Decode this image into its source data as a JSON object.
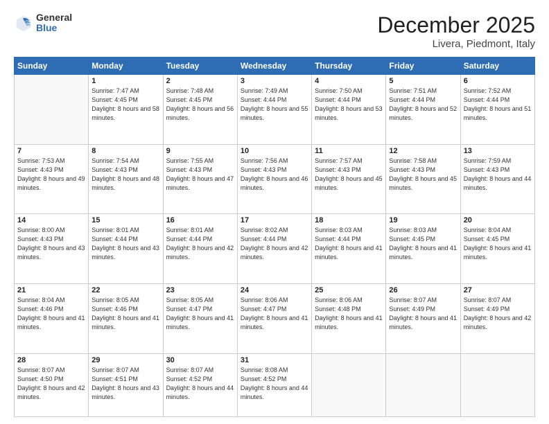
{
  "header": {
    "logo_general": "General",
    "logo_blue": "Blue",
    "month": "December 2025",
    "location": "Livera, Piedmont, Italy"
  },
  "days_of_week": [
    "Sunday",
    "Monday",
    "Tuesday",
    "Wednesday",
    "Thursday",
    "Friday",
    "Saturday"
  ],
  "weeks": [
    [
      {
        "day": "",
        "detail": ""
      },
      {
        "day": "1",
        "detail": "Sunrise: 7:47 AM\nSunset: 4:45 PM\nDaylight: 8 hours\nand 58 minutes."
      },
      {
        "day": "2",
        "detail": "Sunrise: 7:48 AM\nSunset: 4:45 PM\nDaylight: 8 hours\nand 56 minutes."
      },
      {
        "day": "3",
        "detail": "Sunrise: 7:49 AM\nSunset: 4:44 PM\nDaylight: 8 hours\nand 55 minutes."
      },
      {
        "day": "4",
        "detail": "Sunrise: 7:50 AM\nSunset: 4:44 PM\nDaylight: 8 hours\nand 53 minutes."
      },
      {
        "day": "5",
        "detail": "Sunrise: 7:51 AM\nSunset: 4:44 PM\nDaylight: 8 hours\nand 52 minutes."
      },
      {
        "day": "6",
        "detail": "Sunrise: 7:52 AM\nSunset: 4:44 PM\nDaylight: 8 hours\nand 51 minutes."
      }
    ],
    [
      {
        "day": "7",
        "detail": "Sunrise: 7:53 AM\nSunset: 4:43 PM\nDaylight: 8 hours\nand 49 minutes."
      },
      {
        "day": "8",
        "detail": "Sunrise: 7:54 AM\nSunset: 4:43 PM\nDaylight: 8 hours\nand 48 minutes."
      },
      {
        "day": "9",
        "detail": "Sunrise: 7:55 AM\nSunset: 4:43 PM\nDaylight: 8 hours\nand 47 minutes."
      },
      {
        "day": "10",
        "detail": "Sunrise: 7:56 AM\nSunset: 4:43 PM\nDaylight: 8 hours\nand 46 minutes."
      },
      {
        "day": "11",
        "detail": "Sunrise: 7:57 AM\nSunset: 4:43 PM\nDaylight: 8 hours\nand 45 minutes."
      },
      {
        "day": "12",
        "detail": "Sunrise: 7:58 AM\nSunset: 4:43 PM\nDaylight: 8 hours\nand 45 minutes."
      },
      {
        "day": "13",
        "detail": "Sunrise: 7:59 AM\nSunset: 4:43 PM\nDaylight: 8 hours\nand 44 minutes."
      }
    ],
    [
      {
        "day": "14",
        "detail": "Sunrise: 8:00 AM\nSunset: 4:43 PM\nDaylight: 8 hours\nand 43 minutes."
      },
      {
        "day": "15",
        "detail": "Sunrise: 8:01 AM\nSunset: 4:44 PM\nDaylight: 8 hours\nand 43 minutes."
      },
      {
        "day": "16",
        "detail": "Sunrise: 8:01 AM\nSunset: 4:44 PM\nDaylight: 8 hours\nand 42 minutes."
      },
      {
        "day": "17",
        "detail": "Sunrise: 8:02 AM\nSunset: 4:44 PM\nDaylight: 8 hours\nand 42 minutes."
      },
      {
        "day": "18",
        "detail": "Sunrise: 8:03 AM\nSunset: 4:44 PM\nDaylight: 8 hours\nand 41 minutes."
      },
      {
        "day": "19",
        "detail": "Sunrise: 8:03 AM\nSunset: 4:45 PM\nDaylight: 8 hours\nand 41 minutes."
      },
      {
        "day": "20",
        "detail": "Sunrise: 8:04 AM\nSunset: 4:45 PM\nDaylight: 8 hours\nand 41 minutes."
      }
    ],
    [
      {
        "day": "21",
        "detail": "Sunrise: 8:04 AM\nSunset: 4:46 PM\nDaylight: 8 hours\nand 41 minutes."
      },
      {
        "day": "22",
        "detail": "Sunrise: 8:05 AM\nSunset: 4:46 PM\nDaylight: 8 hours\nand 41 minutes."
      },
      {
        "day": "23",
        "detail": "Sunrise: 8:05 AM\nSunset: 4:47 PM\nDaylight: 8 hours\nand 41 minutes."
      },
      {
        "day": "24",
        "detail": "Sunrise: 8:06 AM\nSunset: 4:47 PM\nDaylight: 8 hours\nand 41 minutes."
      },
      {
        "day": "25",
        "detail": "Sunrise: 8:06 AM\nSunset: 4:48 PM\nDaylight: 8 hours\nand 41 minutes."
      },
      {
        "day": "26",
        "detail": "Sunrise: 8:07 AM\nSunset: 4:49 PM\nDaylight: 8 hours\nand 41 minutes."
      },
      {
        "day": "27",
        "detail": "Sunrise: 8:07 AM\nSunset: 4:49 PM\nDaylight: 8 hours\nand 42 minutes."
      }
    ],
    [
      {
        "day": "28",
        "detail": "Sunrise: 8:07 AM\nSunset: 4:50 PM\nDaylight: 8 hours\nand 42 minutes."
      },
      {
        "day": "29",
        "detail": "Sunrise: 8:07 AM\nSunset: 4:51 PM\nDaylight: 8 hours\nand 43 minutes."
      },
      {
        "day": "30",
        "detail": "Sunrise: 8:07 AM\nSunset: 4:52 PM\nDaylight: 8 hours\nand 44 minutes."
      },
      {
        "day": "31",
        "detail": "Sunrise: 8:08 AM\nSunset: 4:52 PM\nDaylight: 8 hours\nand 44 minutes."
      },
      {
        "day": "",
        "detail": ""
      },
      {
        "day": "",
        "detail": ""
      },
      {
        "day": "",
        "detail": ""
      }
    ]
  ]
}
